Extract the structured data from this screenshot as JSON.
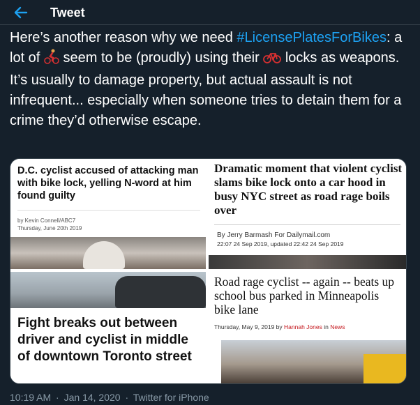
{
  "header": {
    "back_icon": "back-arrow-icon",
    "title": "Tweet"
  },
  "tweet": {
    "text_part1": "Here’s another reason why we need ",
    "hashtag": "#LicensePlatesForBikes",
    "text_part2": ": a lot of ",
    "emoji1": "🚴",
    "text_part3": " seem to be (proudly) using their ",
    "emoji2": "🚲",
    "text_part4": " locks as weapons. It’s usually to damage property, but actual assault is not infrequent... especially when someone tries to detain them for a crime they’d otherwise escape.",
    "hashtag_color": "#1da1f2"
  },
  "media": {
    "card1": {
      "headline": "D.C. cyclist accused of attacking man with bike lock, yelling N-word at him found guilty",
      "byline": "by Kevin Connell/ABC7",
      "date": "Thursday, June 20th 2019"
    },
    "card2": {
      "headline": "Dramatic moment that violent cyclist slams bike lock onto a car hood in busy NYC street as road rage boils over",
      "byline": "By Jerry Barmash For Dailymail.com",
      "date": "22:07 24 Sep 2019, updated 22:42 24 Sep 2019"
    },
    "card3": {
      "headline": "Fight breaks out between driver and cyclist in middle of downtown Toronto street"
    },
    "card4": {
      "headline": "Road rage cyclist -- again -- beats up school bus parked in Minneapolis bike lane",
      "date_prefix": "Thursday, May 9, 2019 by ",
      "author": "Hannah Jones",
      "in_word": " in ",
      "section": "News"
    }
  },
  "meta": {
    "time": "10:19 AM",
    "sep1": "·",
    "date": "Jan 14, 2020",
    "sep2": "·",
    "source": "Twitter for iPhone"
  },
  "colors": {
    "background": "#15202b",
    "accent": "#1da1f2",
    "muted": "#8899a6"
  }
}
